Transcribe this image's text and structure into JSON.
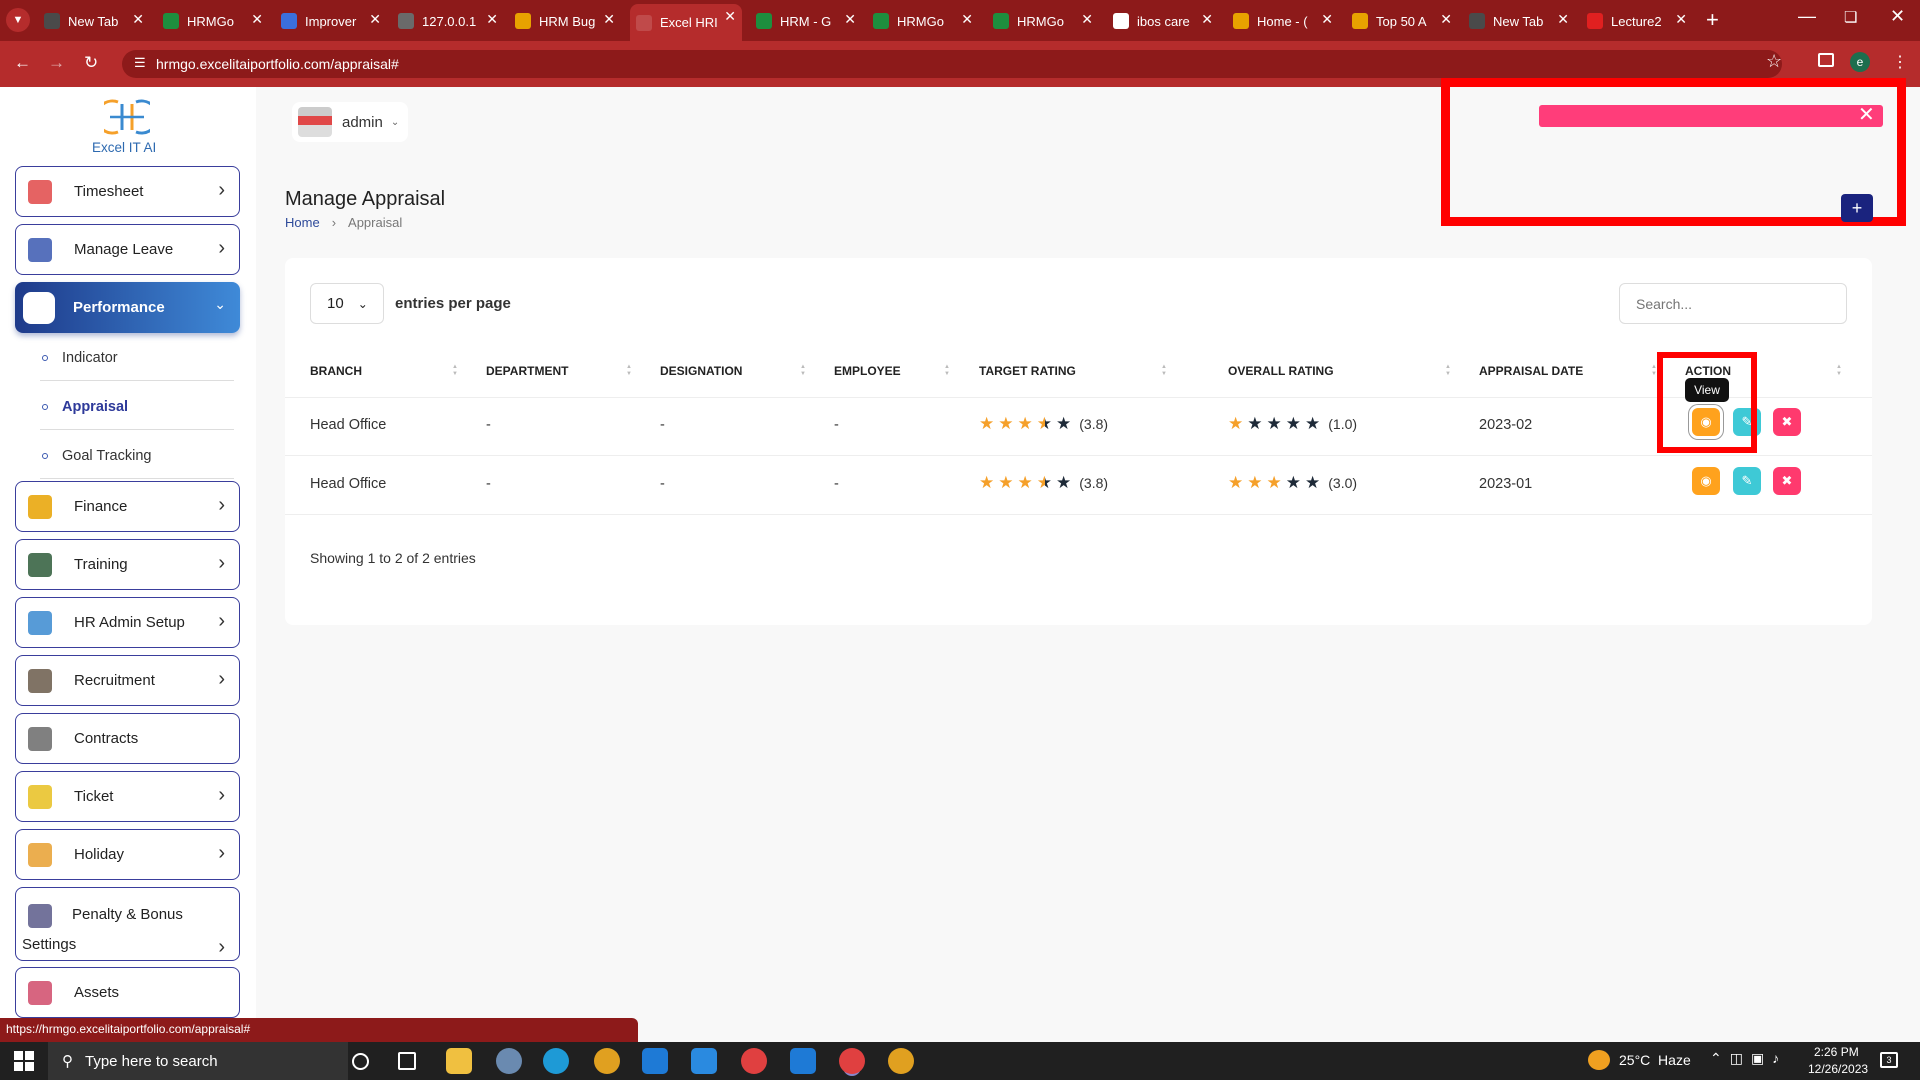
{
  "browser": {
    "tabs": [
      {
        "title": "New Tab",
        "color": "#4a4a4a"
      },
      {
        "title": "HRMGo",
        "color": "#1e8e3e"
      },
      {
        "title": "Improver",
        "color": "#3b6fdc"
      },
      {
        "title": "127.0.0.1",
        "color": "#6a6a6a"
      },
      {
        "title": "HRM Bug",
        "color": "#e8a200"
      },
      {
        "title": "Excel HRI",
        "color": "#c04a4a"
      },
      {
        "title": "HRM - G",
        "color": "#1e8e3e"
      },
      {
        "title": "HRMGo",
        "color": "#1e8e3e"
      },
      {
        "title": "HRMGo",
        "color": "#1e8e3e"
      },
      {
        "title": "ibos care",
        "color": "#ffffff"
      },
      {
        "title": "Home - (",
        "color": "#e8a200"
      },
      {
        "title": "Top 50 A",
        "color": "#e8a200"
      },
      {
        "title": "New Tab",
        "color": "#4a4a4a"
      },
      {
        "title": "Lecture2",
        "color": "#e02020"
      }
    ],
    "url": "hrmgo.excelitaiportfolio.com/appraisal#",
    "status_url": "https://hrmgo.excelitaiportfolio.com/appraisal#",
    "profile_initial": "e"
  },
  "brand": {
    "name": "Excel IT AI"
  },
  "user": {
    "name": "admin"
  },
  "sidebar": {
    "items": [
      {
        "label": "Timesheet",
        "color": "#e04848"
      },
      {
        "label": "Manage Leave",
        "color": "#3a58b0"
      },
      {
        "label": "Performance",
        "color": "#ffffff"
      },
      {
        "label": "Finance",
        "color": "#e8a200"
      },
      {
        "label": "Training",
        "color": "#2e5c3a"
      },
      {
        "label": "HR Admin Setup",
        "color": "#3a8ad0"
      },
      {
        "label": "Recruitment",
        "color": "#6a5a4a"
      },
      {
        "label": "Contracts",
        "color": "#6a6a6a"
      },
      {
        "label": "Ticket",
        "color": "#e8c020"
      },
      {
        "label": "Holiday",
        "color": "#e8a030"
      },
      {
        "label": "Penalty & Bonus Settings",
        "color": "#5a5a8a"
      },
      {
        "label": "Assets",
        "color": "#d04a6a"
      }
    ],
    "sub_items": [
      "Indicator",
      "Appraisal",
      "Goal Tracking"
    ]
  },
  "page": {
    "title": "Manage Appraisal",
    "breadcrumb": [
      "Home",
      "Appraisal"
    ]
  },
  "table": {
    "entries_value": "10",
    "entries_label": "entries per page",
    "search_placeholder": "Search...",
    "columns": [
      "BRANCH",
      "DEPARTMENT",
      "DESIGNATION",
      "EMPLOYEE",
      "TARGET RATING",
      "OVERALL RATING",
      "APPRAISAL DATE",
      "ACTION"
    ],
    "rows": [
      {
        "branch": "Head Office",
        "department": "-",
        "designation": "-",
        "employee": "-",
        "target_rating": 3.8,
        "target_text": "(3.8)",
        "overall_rating": 1.0,
        "overall_text": "(1.0)",
        "date": "2023-02"
      },
      {
        "branch": "Head Office",
        "department": "-",
        "designation": "-",
        "employee": "-",
        "target_rating": 3.8,
        "target_text": "(3.8)",
        "overall_rating": 3.0,
        "overall_text": "(3.0)",
        "date": "2023-01"
      }
    ],
    "footer": "Showing 1 to 2 of 2 entries",
    "tooltip": "View"
  },
  "taskbar": {
    "search_placeholder": "Type here to search",
    "weather": "25°C  Haze",
    "time": "2:26 PM",
    "date": "12/26/2023",
    "notifications": "3"
  },
  "colors": {
    "browser_red": "#8d1a1a",
    "accent_blue": "#3a3e9c",
    "star_orange": "#f5a02a",
    "star_dark": "#1e2a38",
    "toast_pink": "#ff3d7a",
    "view_btn": "#ffa21d",
    "edit_btn": "#3ec9d6",
    "delete_btn": "#ff3a6e",
    "add_btn": "#1a237e",
    "highlight_red": "#ff0000"
  }
}
